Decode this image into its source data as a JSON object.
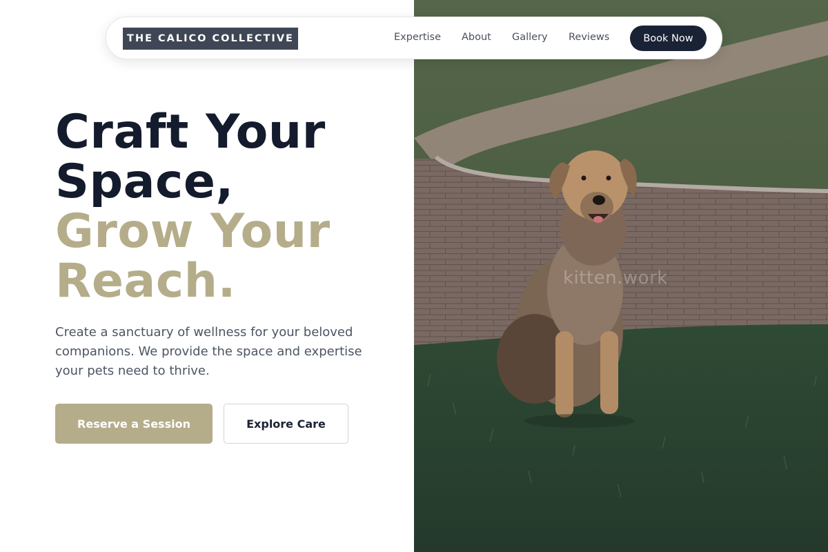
{
  "brand": {
    "name": "THE CALICO COLLECTIVE"
  },
  "nav": {
    "links": [
      "Expertise",
      "About",
      "Gallery",
      "Reviews"
    ],
    "cta": "Book Now"
  },
  "hero": {
    "headline_line1": "Craft Your",
    "headline_line2": "Space,",
    "headline_line3": "Grow Your",
    "headline_line4": "Reach.",
    "subtitle": "Create a sanctuary of wellness for your beloved companions. We provide the space and expertise your pets need to thrive.",
    "primary_button": "Reserve a Session",
    "secondary_button": "Explore Care"
  },
  "photo": {
    "watermark": "kitten.work",
    "subject": "dog sitting on grass beside brick path"
  },
  "colors": {
    "dark": "#131b2c",
    "accent": "#b5ad8a",
    "logo_bg": "#3f4756",
    "cta_bg": "#1a2236"
  }
}
